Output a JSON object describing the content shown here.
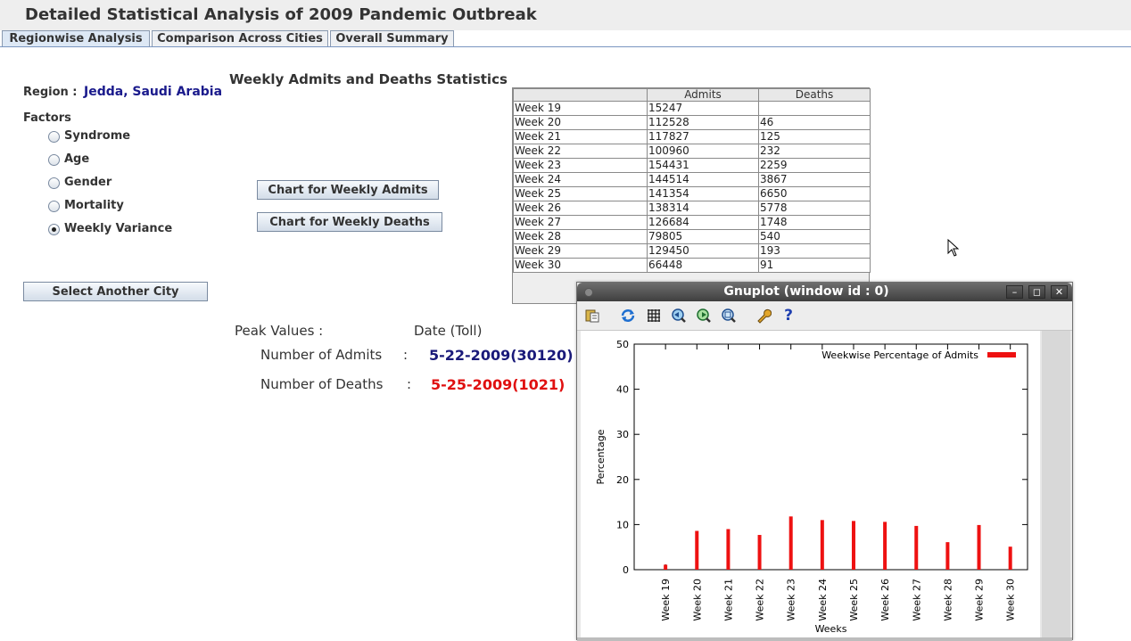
{
  "app_title": "Detailed Statistical Analysis of 2009 Pandemic Outbreak",
  "tabs": [
    "Regionwise Analysis",
    "Comparison Across Cities",
    "Overall Summary"
  ],
  "region": {
    "label": "Region :",
    "value": "Jedda, Saudi Arabia"
  },
  "factors": {
    "label": "Factors",
    "options": [
      {
        "label": "Syndrome",
        "checked": false
      },
      {
        "label": "Age",
        "checked": false
      },
      {
        "label": "Gender",
        "checked": false
      },
      {
        "label": "Mortality",
        "checked": false
      },
      {
        "label": "Weekly Variance",
        "checked": true
      }
    ]
  },
  "buttons": {
    "select_city": "Select Another City",
    "chart_admits": "Chart for Weekly Admits",
    "chart_deaths": "Chart for Weekly Deaths"
  },
  "stats": {
    "heading": "Weekly Admits and Deaths Statistics",
    "columns": [
      "",
      "Admits",
      "Deaths"
    ],
    "rows": [
      [
        "Week 19",
        "15247",
        ""
      ],
      [
        "Week 20",
        "112528",
        "46"
      ],
      [
        "Week 21",
        "117827",
        "125"
      ],
      [
        "Week 22",
        "100960",
        "232"
      ],
      [
        "Week 23",
        "154431",
        "2259"
      ],
      [
        "Week 24",
        "144514",
        "3867"
      ],
      [
        "Week 25",
        "141354",
        "6650"
      ],
      [
        "Week 26",
        "138314",
        "5778"
      ],
      [
        "Week 27",
        "126684",
        "1748"
      ],
      [
        "Week 28",
        "79805",
        "540"
      ],
      [
        "Week 29",
        "129450",
        "193"
      ],
      [
        "Week 30",
        "66448",
        "91"
      ]
    ]
  },
  "peak": {
    "header_left": "Peak Values :",
    "header_right": "Date (Toll)",
    "admits_label": "Number of Admits",
    "deaths_label": "Number of Deaths",
    "colon": ":",
    "admits_value": "5-22-2009(30120)",
    "deaths_value": "5-25-2009(1021)",
    "admits_color": "#1a1a7a",
    "deaths_color": "#e01010"
  },
  "gnuplot": {
    "title": "Gnuplot (window id : 0)",
    "toolbar_icons": [
      "copy-icon",
      "replot-icon",
      "grid-icon",
      "zoom-previous-icon",
      "zoom-next-icon",
      "autoscale-icon",
      "config-icon",
      "help-icon"
    ],
    "window_controls": [
      "minimize-icon",
      "maximize-icon",
      "close-icon"
    ]
  },
  "chart_data": {
    "type": "bar",
    "categories": [
      "Week 19",
      "Week 20",
      "Week 21",
      "Week 22",
      "Week 23",
      "Week 24",
      "Week 25",
      "Week 26",
      "Week 27",
      "Week 28",
      "Week 29",
      "Week 30"
    ],
    "series": [
      {
        "name": "Weekwise Percentage of Admits",
        "values": [
          1.1,
          8.6,
          9.0,
          7.7,
          11.8,
          11.0,
          10.8,
          10.6,
          9.7,
          6.1,
          9.9,
          5.1
        ]
      }
    ],
    "xlabel": "Weeks",
    "ylabel": "Percentage",
    "ylim": [
      0,
      50
    ],
    "yticks": [
      0,
      10,
      20,
      30,
      40,
      50
    ],
    "bar_color": "#ee1111",
    "legend_position": "top-right",
    "grid": false
  }
}
